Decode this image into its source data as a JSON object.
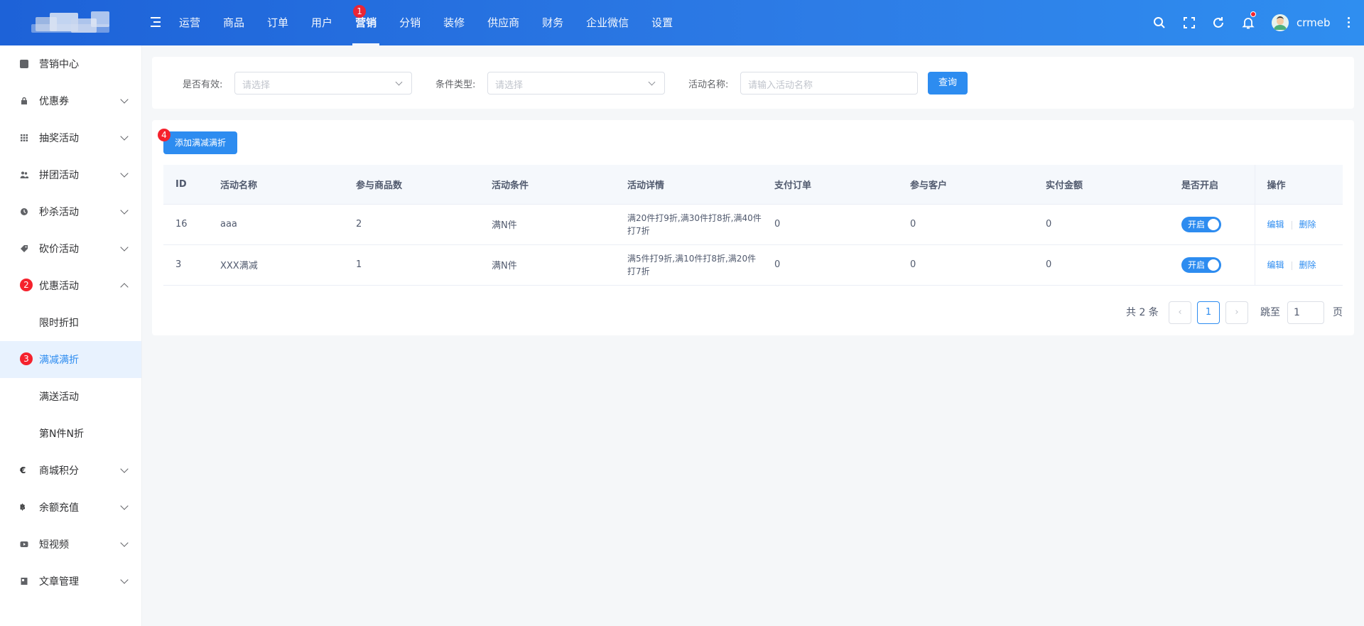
{
  "header": {
    "nav": [
      {
        "label": "运营"
      },
      {
        "label": "商品"
      },
      {
        "label": "订单"
      },
      {
        "label": "用户"
      },
      {
        "label": "营销",
        "badge": "1",
        "active": true
      },
      {
        "label": "分销"
      },
      {
        "label": "装修"
      },
      {
        "label": "供应商"
      },
      {
        "label": "财务"
      },
      {
        "label": "企业微信"
      },
      {
        "label": "设置"
      }
    ],
    "username": "crmeb"
  },
  "sidebar": {
    "items": [
      {
        "label": "营销中心",
        "icon": "book-icon"
      },
      {
        "label": "优惠券",
        "icon": "lock-icon"
      },
      {
        "label": "抽奖活动",
        "icon": "grid-icon"
      },
      {
        "label": "拼团活动",
        "icon": "group-icon"
      },
      {
        "label": "秒杀活动",
        "icon": "clock-icon"
      },
      {
        "label": "砍价活动",
        "icon": "tag-icon"
      },
      {
        "label": "优惠活动",
        "badge": "2",
        "sub": [
          {
            "label": "限时折扣"
          },
          {
            "label": "满减满折",
            "badge": "3",
            "active": true
          },
          {
            "label": "满送活动"
          },
          {
            "label": "第N件N折"
          }
        ]
      },
      {
        "label": "商城积分",
        "icon": "euro-icon"
      },
      {
        "label": "余额充值",
        "icon": "bitcoin-icon"
      },
      {
        "label": "短视频",
        "icon": "video-icon"
      },
      {
        "label": "文章管理",
        "icon": "article-icon"
      }
    ]
  },
  "filter": {
    "valid_label": "是否有效:",
    "valid_placeholder": "请选择",
    "type_label": "条件类型:",
    "type_placeholder": "请选择",
    "name_label": "活动名称:",
    "name_placeholder": "请输入活动名称",
    "search_button": "查询"
  },
  "add_button": {
    "label": "添加满减满折",
    "badge": "4"
  },
  "table": {
    "headers": [
      "ID",
      "活动名称",
      "参与商品数",
      "活动条件",
      "活动详情",
      "支付订单",
      "参与客户",
      "实付金额",
      "是否开启",
      "操作"
    ],
    "rows": [
      {
        "id": "16",
        "name": "aaa",
        "goods": "2",
        "condition": "满N件",
        "detail": "满20件打9折,满30件打8折,满40件打7折",
        "orders": "0",
        "customers": "0",
        "amount": "0",
        "switch": "开启",
        "edit": "编辑",
        "delete": "删除"
      },
      {
        "id": "3",
        "name": "XXX满减",
        "goods": "1",
        "condition": "满N件",
        "detail": "满5件打9折,满10件打8折,满20件打7折",
        "orders": "0",
        "customers": "0",
        "amount": "0",
        "switch": "开启",
        "edit": "编辑",
        "delete": "删除"
      }
    ]
  },
  "pagination": {
    "total_text": "共 2 条",
    "current_page": "1",
    "jump_label": "跳至",
    "jump_value": "1",
    "page_unit": "页"
  }
}
